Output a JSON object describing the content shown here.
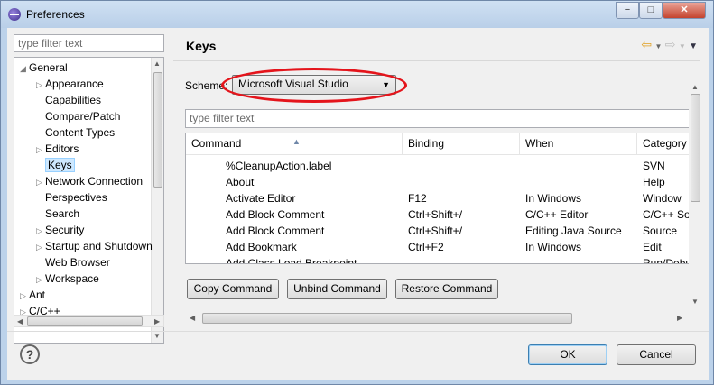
{
  "window": {
    "title": "Preferences",
    "min": "−",
    "max": "□",
    "close": "✕"
  },
  "left": {
    "filter_placeholder": "type filter text",
    "tree": [
      {
        "label": "General",
        "toggle": "◢",
        "indent": 0
      },
      {
        "label": "Appearance",
        "toggle": "▷",
        "indent": 1
      },
      {
        "label": "Capabilities",
        "toggle": "",
        "indent": 1
      },
      {
        "label": "Compare/Patch",
        "toggle": "",
        "indent": 1
      },
      {
        "label": "Content Types",
        "toggle": "",
        "indent": 1
      },
      {
        "label": "Editors",
        "toggle": "▷",
        "indent": 1
      },
      {
        "label": "Keys",
        "toggle": "",
        "indent": 1,
        "selected": true
      },
      {
        "label": "Network Connection",
        "toggle": "▷",
        "indent": 1
      },
      {
        "label": "Perspectives",
        "toggle": "",
        "indent": 1
      },
      {
        "label": "Search",
        "toggle": "",
        "indent": 1
      },
      {
        "label": "Security",
        "toggle": "▷",
        "indent": 1
      },
      {
        "label": "Startup and Shutdown",
        "toggle": "▷",
        "indent": 1
      },
      {
        "label": "Web Browser",
        "toggle": "",
        "indent": 1
      },
      {
        "label": "Workspace",
        "toggle": "▷",
        "indent": 1
      },
      {
        "label": "Ant",
        "toggle": "▷",
        "indent": 0
      },
      {
        "label": "C/C++",
        "toggle": "▷",
        "indent": 0
      }
    ]
  },
  "right": {
    "title": "Keys",
    "scheme_label": "Scheme:",
    "scheme_value": "Microsoft Visual Studio",
    "filter_placeholder": "type filter text",
    "columns": [
      "Command",
      "Binding",
      "When",
      "Category"
    ],
    "rows": [
      [
        "%CleanupAction.label",
        "",
        "",
        "SVN"
      ],
      [
        "About",
        "",
        "",
        "Help"
      ],
      [
        "Activate Editor",
        "F12",
        "In Windows",
        "Window"
      ],
      [
        "Add Block Comment",
        "Ctrl+Shift+/",
        "C/C++ Editor",
        "C/C++ Source"
      ],
      [
        "Add Block Comment",
        "Ctrl+Shift+/",
        "Editing Java Source",
        "Source"
      ],
      [
        "Add Bookmark",
        "Ctrl+F2",
        "In Windows",
        "Edit"
      ],
      [
        "Add Class Load Breakpoint",
        "",
        "",
        "Run/Debug"
      ]
    ],
    "buttons": {
      "copy": "Copy Command",
      "unbind": "Unbind Command",
      "restore": "Restore Command"
    }
  },
  "footer": {
    "ok": "OK",
    "cancel": "Cancel",
    "help": "?"
  }
}
